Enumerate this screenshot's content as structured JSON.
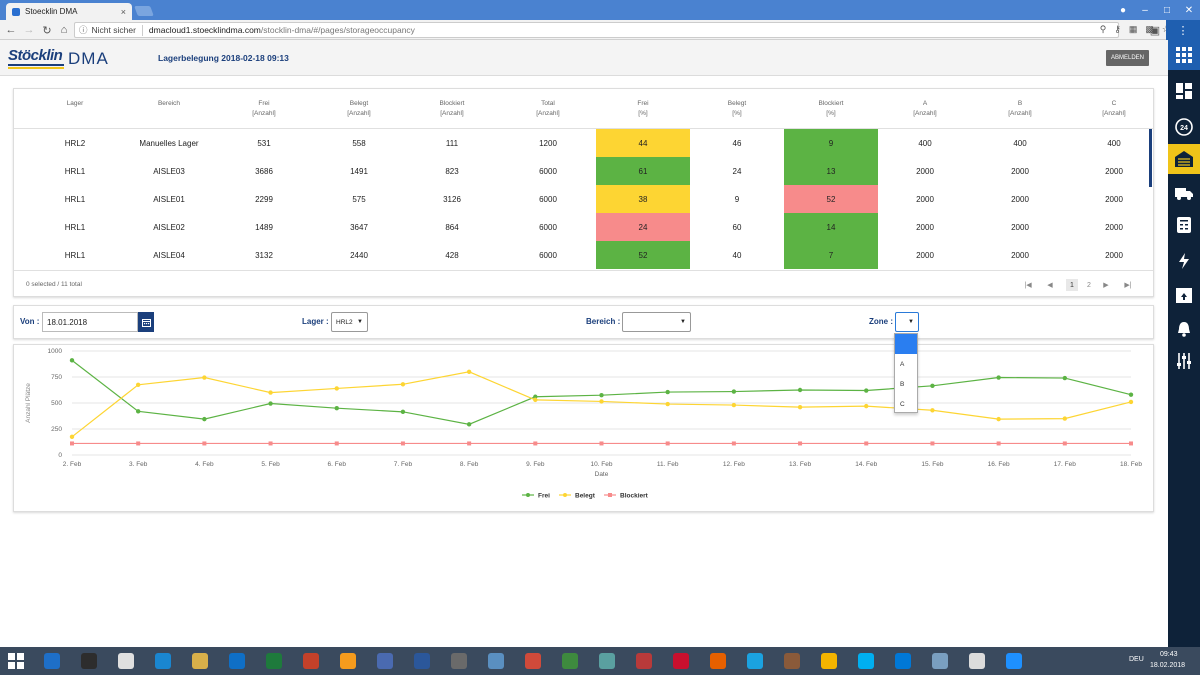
{
  "browser": {
    "tab_title": "Stoecklin DMA",
    "tab_close": "×",
    "security_label": "Nicht sicher",
    "url_host": "dmacloud1.stoecklindma.com",
    "url_path": "/stocklin-dma/#/pages/storageoccupancy"
  },
  "header": {
    "logo_text": "Stöcklin",
    "logo_product": "DMA",
    "title": "Lagerbelegung 2018-02-18 09:13",
    "logout_label": "ABMELDEN"
  },
  "table": {
    "columns": [
      {
        "label": "Lager",
        "unit": ""
      },
      {
        "label": "Bereich",
        "unit": ""
      },
      {
        "label": "Frei",
        "unit": "[Anzahl]"
      },
      {
        "label": "Belegt",
        "unit": "[Anzahl]"
      },
      {
        "label": "Blockiert",
        "unit": "[Anzahl]"
      },
      {
        "label": "Total",
        "unit": "[Anzahl]"
      },
      {
        "label": "Frei",
        "unit": "[%]"
      },
      {
        "label": "Belegt",
        "unit": "[%]"
      },
      {
        "label": "Blockiert",
        "unit": "[%]"
      },
      {
        "label": "A",
        "unit": "[Anzahl]"
      },
      {
        "label": "B",
        "unit": "[Anzahl]"
      },
      {
        "label": "C",
        "unit": "[Anzahl]"
      }
    ],
    "rows": [
      {
        "cells": [
          "HRL2",
          "Manuelles Lager",
          "531",
          "558",
          "111",
          "1200",
          "44",
          "46",
          "9",
          "400",
          "400",
          "400"
        ],
        "frei_pct_status": "yellow",
        "blockiert_pct_status": "green"
      },
      {
        "cells": [
          "HRL1",
          "AISLE03",
          "3686",
          "1491",
          "823",
          "6000",
          "61",
          "24",
          "13",
          "2000",
          "2000",
          "2000"
        ],
        "frei_pct_status": "green",
        "blockiert_pct_status": "green"
      },
      {
        "cells": [
          "HRL1",
          "AISLE01",
          "2299",
          "575",
          "3126",
          "6000",
          "38",
          "9",
          "52",
          "2000",
          "2000",
          "2000"
        ],
        "frei_pct_status": "yellow",
        "blockiert_pct_status": "red"
      },
      {
        "cells": [
          "HRL1",
          "AISLE02",
          "1489",
          "3647",
          "864",
          "6000",
          "24",
          "60",
          "14",
          "2000",
          "2000",
          "2000"
        ],
        "frei_pct_status": "red",
        "blockiert_pct_status": "green"
      },
      {
        "cells": [
          "HRL1",
          "AISLE04",
          "3132",
          "2440",
          "428",
          "6000",
          "52",
          "40",
          "7",
          "2000",
          "2000",
          "2000"
        ],
        "frei_pct_status": "green",
        "blockiert_pct_status": "green"
      }
    ],
    "selection_info": "0 selected / 11 total",
    "pagination": {
      "first": "|◀",
      "prev": "◀",
      "pages": [
        "1",
        "2"
      ],
      "current": "1",
      "next": "▶",
      "last": "▶|"
    }
  },
  "filters": {
    "von_label": "Von :",
    "von_value": "18.01.2018",
    "lager_label": "Lager :",
    "lager_value": "HRL2",
    "bereich_label": "Bereich :",
    "bereich_value": "",
    "zone_label": "Zone :",
    "zone_value": "",
    "zone_options": [
      "",
      "A",
      "B",
      "C"
    ]
  },
  "colors": {
    "frei": "#5cb344",
    "belegt": "#fdd533",
    "blockiert": "#f78b8b",
    "brand": "#1b3f7c",
    "accent": "#f0c419"
  },
  "chart_data": {
    "type": "line",
    "xlabel": "Date",
    "ylabel": "Anzahl Plätze",
    "ylim": [
      0,
      1000
    ],
    "yticks": [
      0,
      250,
      500,
      750,
      1000
    ],
    "categories": [
      "2. Feb",
      "3. Feb",
      "4. Feb",
      "5. Feb",
      "6. Feb",
      "7. Feb",
      "8. Feb",
      "9. Feb",
      "10. Feb",
      "11. Feb",
      "12. Feb",
      "13. Feb",
      "14. Feb",
      "15. Feb",
      "16. Feb",
      "17. Feb",
      "18. Feb"
    ],
    "series": [
      {
        "name": "Frei",
        "color": "#5cb344",
        "values": [
          910,
          420,
          345,
          495,
          450,
          415,
          295,
          560,
          575,
          605,
          610,
          625,
          620,
          665,
          745,
          740,
          580
        ]
      },
      {
        "name": "Belegt",
        "color": "#fdd533",
        "values": [
          175,
          675,
          745,
          600,
          640,
          680,
          800,
          530,
          515,
          490,
          480,
          460,
          470,
          430,
          345,
          350,
          510
        ]
      },
      {
        "name": "Blockiert",
        "color": "#f78b8b",
        "values": [
          111,
          111,
          111,
          111,
          111,
          111,
          111,
          111,
          111,
          111,
          111,
          111,
          111,
          111,
          111,
          111,
          111
        ]
      }
    ],
    "grid": true,
    "legend": "bottom-center"
  },
  "taskbar": {
    "time": "09:43",
    "date": "18.02.2018",
    "lang": "DEU"
  }
}
